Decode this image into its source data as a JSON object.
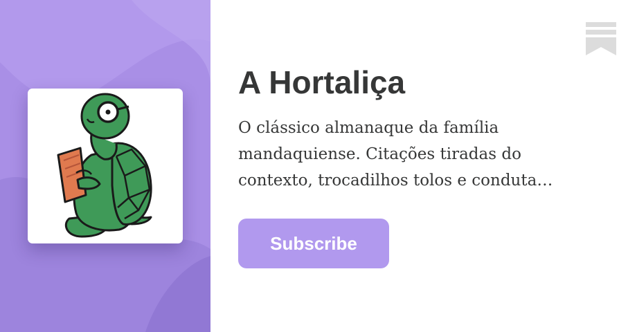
{
  "publication": {
    "title": "A Hortaliça",
    "description": "O clássico almanaque da família mandaquiense. Citações tiradas do contexto, trocadilhos tolos e conduta…",
    "logo": "turtle-reading-book-illustration"
  },
  "actions": {
    "subscribe_label": "Subscribe"
  },
  "icons": {
    "bookmark": "bookmark-icon"
  },
  "colors": {
    "accent": "#b199ee",
    "panel": "#a98fe6",
    "text": "#363737",
    "bookmark": "#dcdcdc",
    "turtle": "#3f9a58",
    "book": "#e07a4f"
  }
}
